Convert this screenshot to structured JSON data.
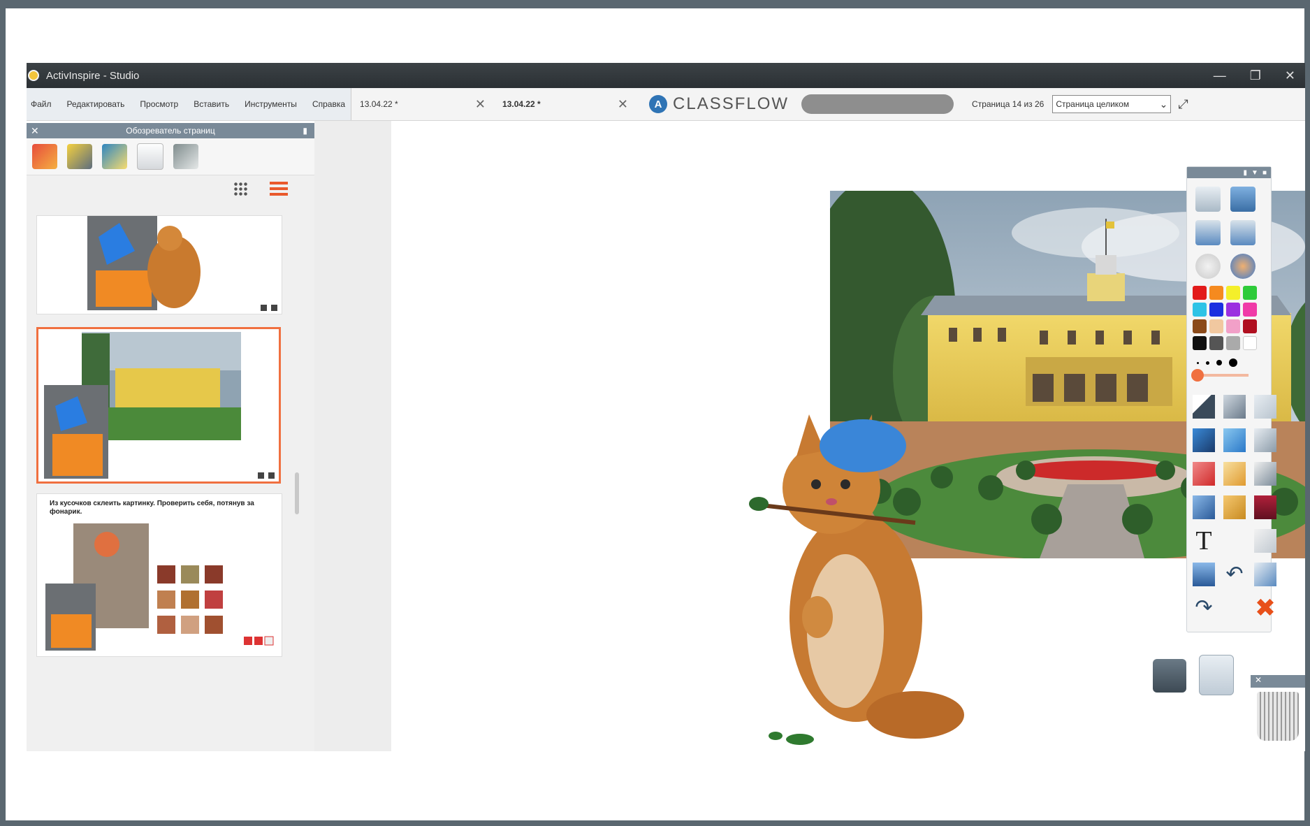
{
  "window": {
    "title": "ActivInspire - Studio"
  },
  "menu": [
    "Файл",
    "Редактировать",
    "Просмотр",
    "Вставить",
    "Инструменты",
    "Справка"
  ],
  "tabs": [
    {
      "label": "13.04.22 *",
      "active": false
    },
    {
      "label": "13.04.22 *",
      "active": true
    }
  ],
  "classflow": {
    "logo_letter": "A",
    "brand": "CLASSFLOW"
  },
  "page_info": {
    "text": "Страница 14 из 26",
    "zoom_option": "Страница целиком"
  },
  "page_browser": {
    "title": "Обозреватель страниц",
    "thumbnail_text": "Из кусочков склеить картинку. Проверить себя, потянув за фонарик."
  },
  "colors": {
    "accent": "#f07040",
    "palette": [
      "#e21b1b",
      "#f58a1f",
      "#f4ef2a",
      "#2ecb3a",
      "#2ec3e6",
      "#1b2fe0",
      "#9b2fe0",
      "#f03aa8",
      "#8a4a1a",
      "#f1c8a0",
      "#f2a0c8",
      "#b01020",
      "#111111",
      "#555555",
      "#aaaaaa",
      "#ffffff"
    ]
  },
  "icons": {
    "close": "close-icon",
    "minimize": "minimize-icon",
    "maximize": "maximize-icon",
    "trash": "trash-icon"
  }
}
